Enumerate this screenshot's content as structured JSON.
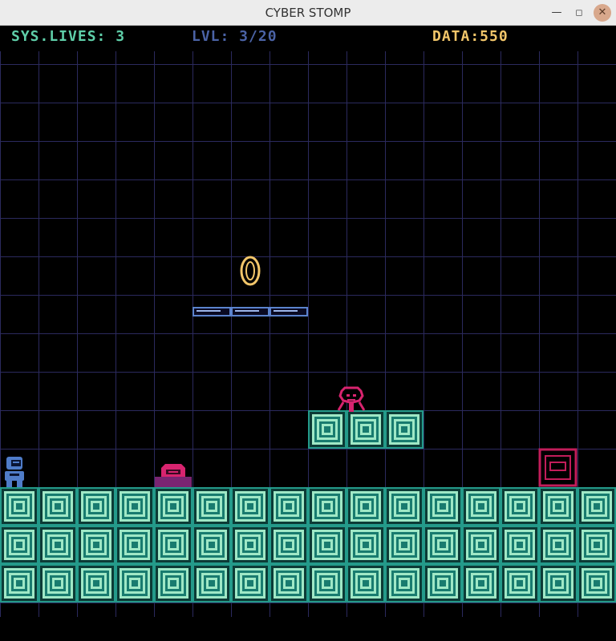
{
  "window": {
    "title": "CYBER STOMP",
    "minimize_glyph": "—",
    "maximize_glyph": "◻",
    "close_glyph": "✕"
  },
  "hud": {
    "lives_text": "SYS.LIVES: 3",
    "level_text": "LVL: 3/20",
    "data_text": "DATA:550"
  },
  "icons": {
    "player": "player-robot-icon",
    "coin": "data-coin-icon",
    "enemy_walker": "walker-drone-icon",
    "enemy_crawler": "crawler-bot-icon",
    "exit": "exit-portal-icon",
    "window_controls": [
      "minimize-icon",
      "maximize-icon",
      "close-icon"
    ]
  },
  "colors": {
    "background": "#000000",
    "grid": "#2b2a5e",
    "tile_fill": "#249a8a",
    "tile_rings": "#9fe8c6",
    "tile_dark": "#0c3b36",
    "player": "#4f7cc8",
    "coin": "#f2c66a",
    "enemy": "#d8246f",
    "crawler_base": "#7a2572",
    "exit": "#c21d5a",
    "platform": "#5b83cd",
    "hud_lives": "#5fcfa9",
    "hud_level": "#4b63a6",
    "hud_data": "#f2c66a"
  }
}
